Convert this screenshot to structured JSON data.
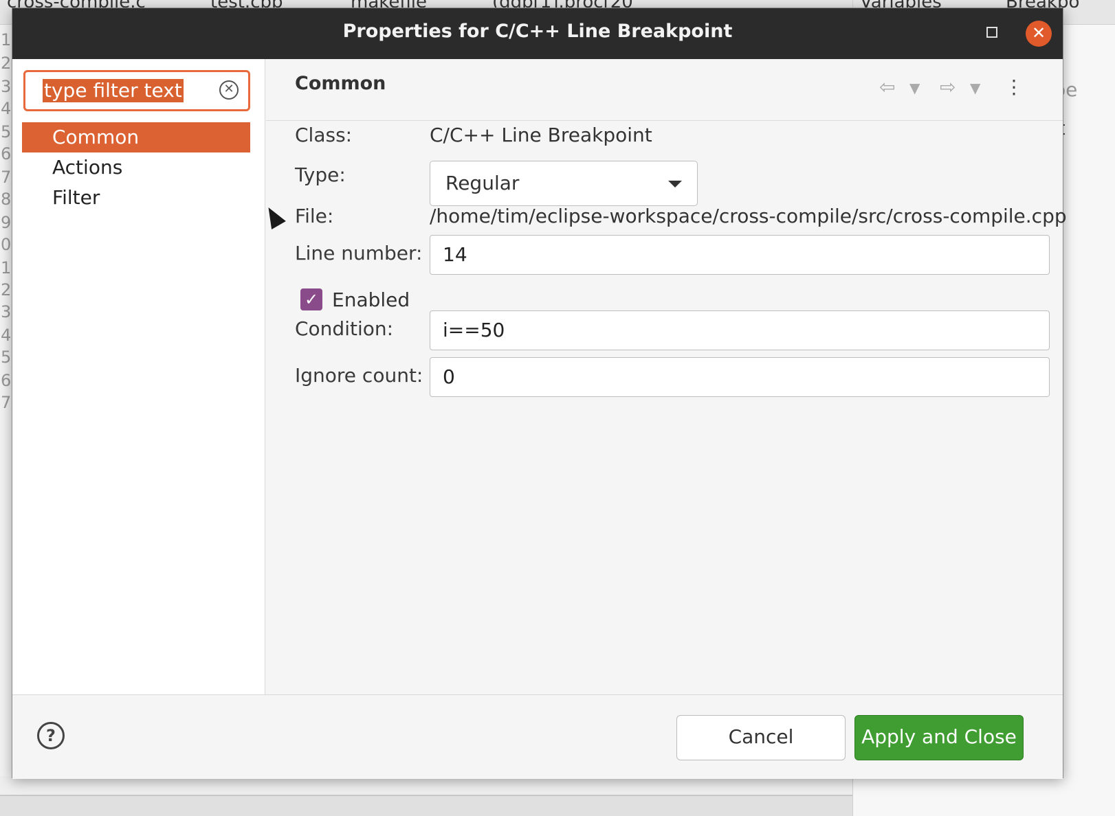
{
  "background": {
    "editor_tabs": [
      "cross-compile.c",
      "test.cpp",
      "makefile",
      "(gdb[1].proc[20"
    ],
    "right_tabs": [
      "Variables",
      "Breakpo"
    ],
    "line_numbers": [
      "1",
      "2",
      "3",
      "4",
      "5",
      "6",
      "7",
      "8",
      "9",
      "0",
      "1",
      "2",
      "3",
      "4",
      "5",
      "6",
      "7"
    ],
    "variables_column_header": "Type",
    "variables_cell": "int"
  },
  "dialog": {
    "title": "Properties for C/C++ Line Breakpoint",
    "filter": {
      "placeholder": "type filter text"
    },
    "nav": [
      {
        "label": "Common"
      },
      {
        "label": "Actions"
      },
      {
        "label": "Filter"
      }
    ],
    "content": {
      "title": "Common",
      "class_label": "Class:",
      "class_value": "C/C++ Line Breakpoint",
      "type_label": "Type:",
      "type_value": "Regular",
      "file_label": "File:",
      "file_value": "/home/tim/eclipse-workspace/cross-compile/src/cross-compile.cpp",
      "line_label": "Line number:",
      "line_value": "14",
      "enabled_label": "Enabled",
      "condition_label": "Condition:",
      "condition_value": "i==50",
      "ignore_label": "Ignore count:",
      "ignore_value": "0"
    },
    "buttons": {
      "cancel": "Cancel",
      "apply": "Apply and Close"
    },
    "help_glyph": "?"
  },
  "colors": {
    "accent": "#dd6233",
    "apply": "#3f9d31",
    "checkbox": "#8a4b8a",
    "titlebar": "#2b2b2b"
  }
}
